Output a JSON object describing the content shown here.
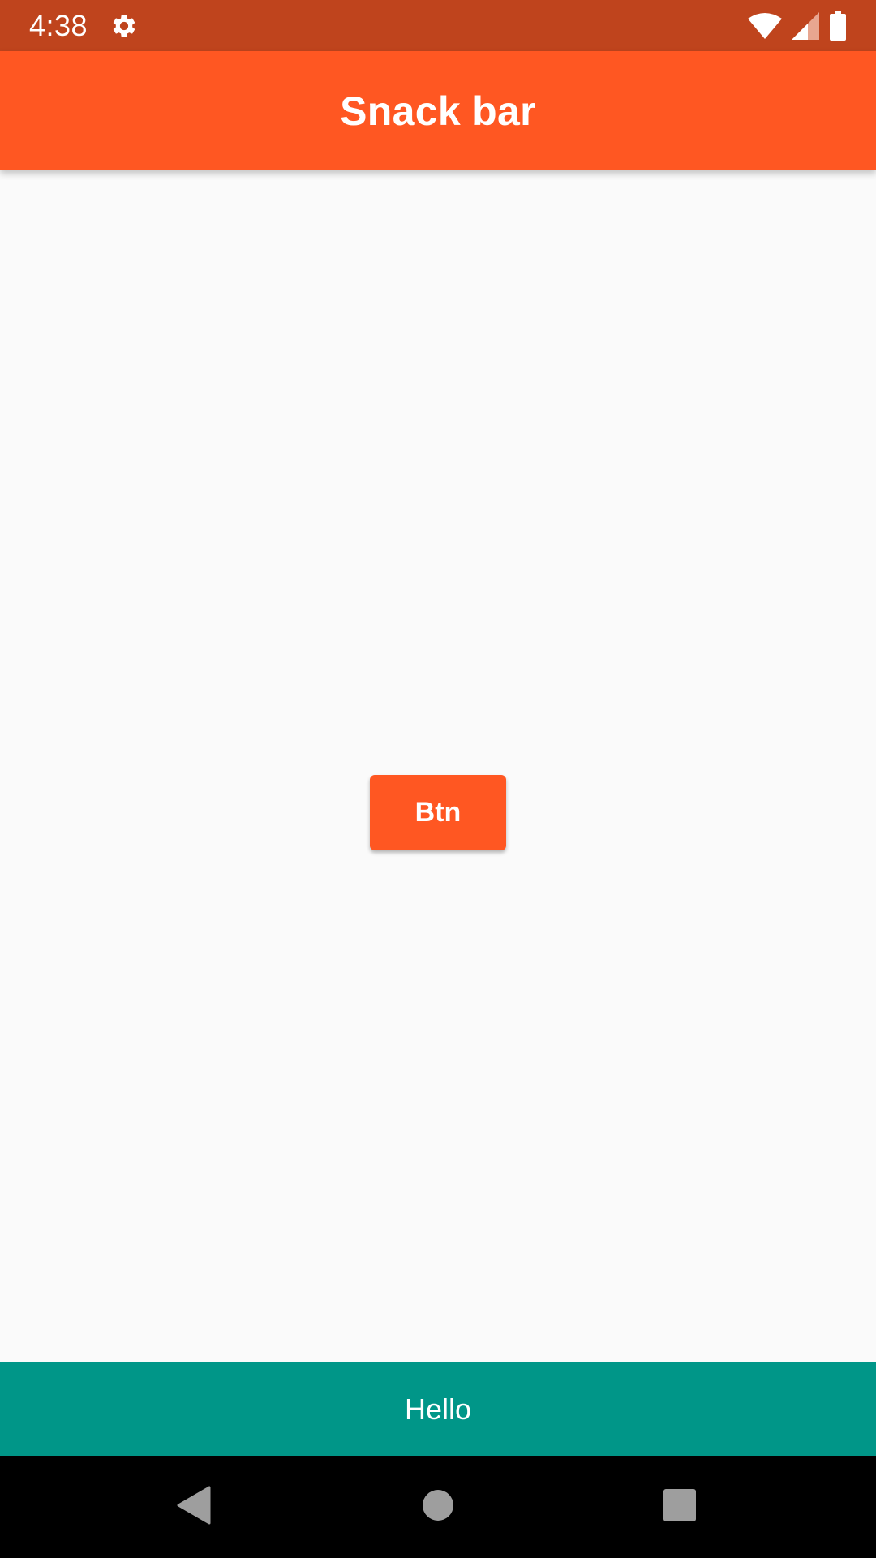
{
  "status_bar": {
    "time": "4:38",
    "icons": [
      "settings-icon",
      "wifi-icon",
      "signal-icon",
      "battery-icon"
    ],
    "color": "#bf441d"
  },
  "app_bar": {
    "title": "Snack bar",
    "color": "#ff5722"
  },
  "content": {
    "button_label": "Btn",
    "button_color": "#ff5722",
    "background": "#fafafa"
  },
  "snackbar": {
    "message": "Hello",
    "color": "#009688"
  },
  "nav_bar": {
    "buttons": [
      "back-icon",
      "home-icon",
      "recents-icon"
    ],
    "color": "#000000"
  }
}
